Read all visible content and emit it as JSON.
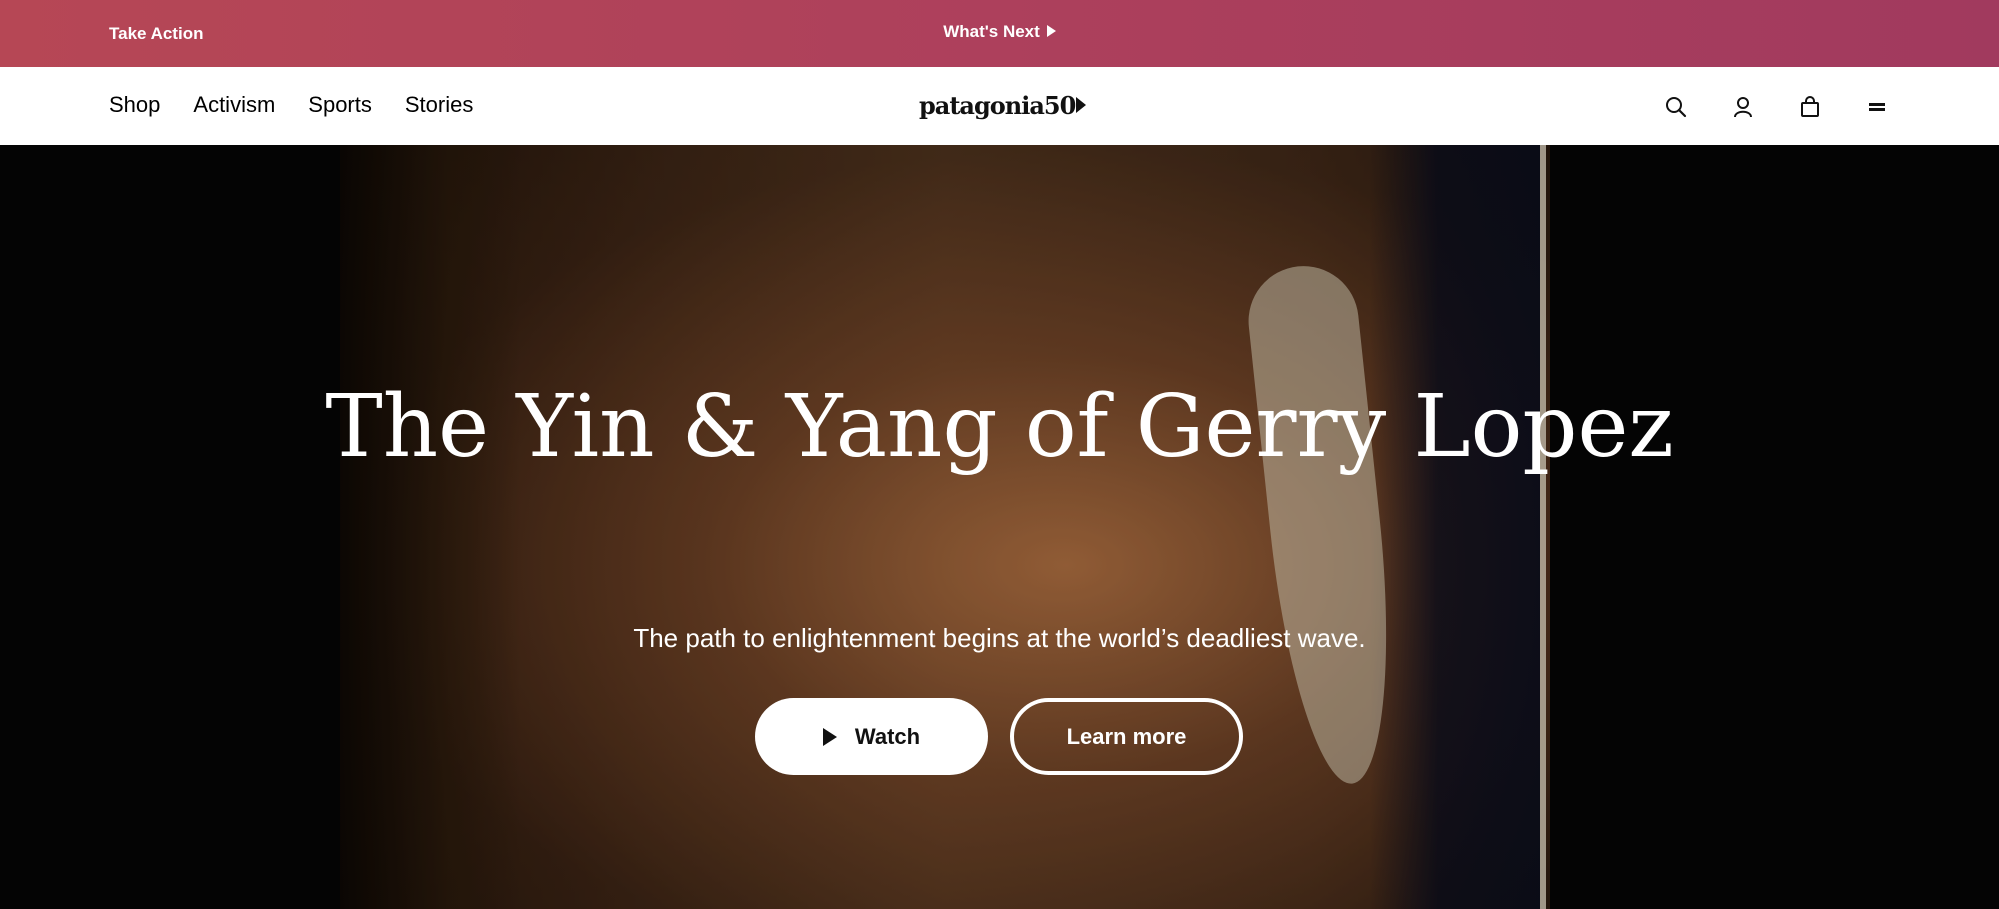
{
  "promo": {
    "left_link": "Take Action",
    "center_link": "What's Next"
  },
  "nav": {
    "items": [
      {
        "label": "Shop"
      },
      {
        "label": "Activism"
      },
      {
        "label": "Sports"
      },
      {
        "label": "Stories"
      }
    ],
    "logo_text": "patagonia50"
  },
  "header_icons": [
    "search-icon",
    "account-icon",
    "shopping-bag-icon",
    "menu-icon"
  ],
  "hero": {
    "title": "The Yin & Yang of Gerry Lopez",
    "subtitle": "The path to enlightenment begins at the world’s deadliest wave.",
    "watch_label": "Watch",
    "learn_more_label": "Learn more"
  },
  "colors": {
    "promo_bar": "#ad405c",
    "header_bg": "#ffffff",
    "text": "#000000"
  }
}
